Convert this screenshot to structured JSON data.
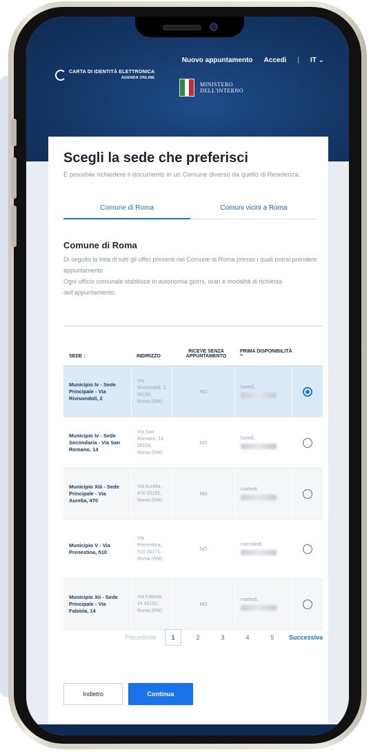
{
  "header": {
    "nav": {
      "new_appointment": "Nuovo appuntamento",
      "login": "Accedi",
      "separator": "|",
      "language": "IT"
    },
    "logo": {
      "line1": "CARTA DI IDENTITÀ ELETTRONICA",
      "line2": "AGENDA ONLINE"
    },
    "ministry": {
      "line1": "MINISTERO",
      "line2": "DELL'INTERNO"
    },
    "colors": {
      "background": "#163a6d",
      "flag_green": "#2e8b3d",
      "flag_white": "#ffffff",
      "flag_red": "#cc2b36"
    }
  },
  "page": {
    "title": "Scegli la sede che preferisci",
    "subtitle": "È possibile richiedere il documento in un Comune diverso da quello di Residenza.",
    "tabs": [
      {
        "label": "Comune di Roma",
        "active": true
      },
      {
        "label": "Comuni vicini a Roma",
        "active": false
      }
    ],
    "section": {
      "title": "Comune di Roma",
      "desc1": "Di seguito la lista di tutti gli uffici presenti nel Comune di Roma presso i quali potrai prendere appuntamento",
      "desc2": "Ogni ufficio comunale stabilisce in autonomia giorni, orari e modalità di richiesta dell'appuntamento."
    }
  },
  "table": {
    "headers": {
      "sede": "SEDE ↕",
      "indirizzo": "INDIRIZZO",
      "senza": "RICEVE SENZA APPUNTAMENTO",
      "disp": "PRIMA DISPONIBILITÀ ^"
    },
    "rows": [
      {
        "sede": "Municipio Iv - Sede Principale - Via Rivisondoli, 2",
        "indirizzo": "Via Rivisondoli, 2 00156, Roma (RM)",
        "senza": "NO",
        "disp": "lunedì,",
        "selected": true
      },
      {
        "sede": "Municipio Iv - Sede Secondaria - Via San Romano, 14",
        "indirizzo": "Via San Romano, 14 00159, Roma (RM)",
        "senza": "NO",
        "disp": "lunedì,",
        "selected": false
      },
      {
        "sede": "Municipio Xiii - Sede Principale - Via Aurelia, 470",
        "indirizzo": "Via Aurelia, 470 00165, Roma (RM)",
        "senza": "NO",
        "disp": "martedì,",
        "selected": false
      },
      {
        "sede": "Municipio V - Via Prenestina, 510",
        "indirizzo": "Via Prenestina, 510 00171, Roma (RM)",
        "senza": "NO",
        "disp": "mercoledì,",
        "selected": false
      },
      {
        "sede": "Municipio Xii - Sede Principale - Via Fabiola, 14",
        "indirizzo": "Via Fabiola, 14 00152, Roma (RM)",
        "senza": "NO",
        "disp": "martedì,",
        "selected": false
      }
    ]
  },
  "pagination": {
    "prev": "Precedente",
    "pages": [
      "1",
      "2",
      "3",
      "4",
      "5"
    ],
    "current": "1",
    "next": "Successiva"
  },
  "actions": {
    "back": "Indietro",
    "continue": "Continua"
  }
}
